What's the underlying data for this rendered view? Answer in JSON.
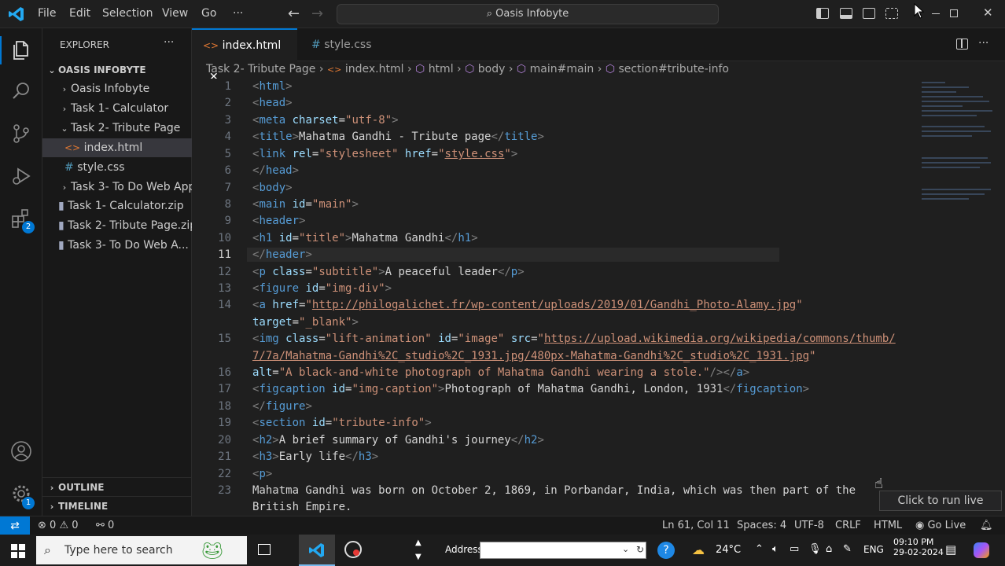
{
  "titlebar": {
    "menus": [
      "File",
      "Edit",
      "Selection",
      "View",
      "Go",
      "···"
    ],
    "search_text": "Oasis Infobyte"
  },
  "activity": {
    "extensions_badge": "2",
    "settings_badge": "1"
  },
  "sidebar": {
    "header": "EXPLORER",
    "more": "···",
    "root": "OASIS INFOBYTE",
    "items": [
      {
        "chev": "›",
        "icon": "",
        "label": "Oasis Infobyte"
      },
      {
        "chev": "›",
        "icon": "",
        "label": "Task 1- Calculator"
      },
      {
        "chev": "⌄",
        "icon": "",
        "label": "Task 2- Tribute Page"
      },
      {
        "chev": "",
        "icon": "<>",
        "label": "index.html"
      },
      {
        "chev": "",
        "icon": "#",
        "label": "style.css"
      },
      {
        "chev": "›",
        "icon": "",
        "label": "Task 3- To Do Web App"
      },
      {
        "chev": "",
        "icon": "▮",
        "label": "Task 1- Calculator.zip"
      },
      {
        "chev": "",
        "icon": "▮",
        "label": "Task 2- Tribute Page.zip"
      },
      {
        "chev": "",
        "icon": "▮",
        "label": "Task 3- To Do Web A..."
      }
    ],
    "outline": "OUTLINE",
    "timeline": "TIMELINE"
  },
  "tabs": [
    {
      "icon": "<>",
      "label": "index.html",
      "close": "✕"
    },
    {
      "icon": "#",
      "label": "style.css"
    }
  ],
  "breadcrumb": {
    "parts": [
      "Task 2- Tribute Page",
      "index.html",
      "html",
      "body",
      "main#main",
      "section#tribute-info"
    ]
  },
  "editor": {
    "line_numbers": [
      "1",
      "2",
      "3",
      "4",
      "5",
      "6",
      "7",
      "8",
      "9",
      "10",
      "11",
      "12",
      "13",
      "14",
      "",
      "15",
      "",
      "16",
      "17",
      "18",
      "19",
      "20",
      "21",
      "22",
      "23",
      ""
    ]
  },
  "tooltip": "Click to run live server",
  "statusbar": {
    "errors": "0",
    "warnings": "0",
    "ports": "0",
    "position": "Ln 61, Col 11",
    "spaces": "Spaces: 4",
    "encoding": "UTF-8",
    "eol": "CRLF",
    "language": "HTML",
    "golive": "Go Live"
  },
  "taskbar": {
    "search_placeholder": "Type here to search",
    "address_label": "Address",
    "weather": "24°C",
    "language": "ENG",
    "time": "09:10 PM",
    "date": "29-02-2024"
  }
}
